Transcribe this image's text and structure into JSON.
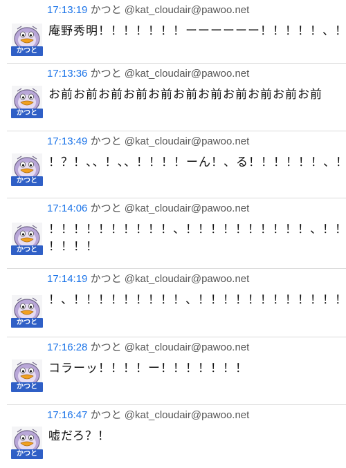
{
  "posts": [
    {
      "time": "17:13:19",
      "name": "かつと",
      "handle": "@kat_cloudair@pawoo.net",
      "lines": [
        "庵野秀明！！！！！！！ーーーーーー！！！！！、！！"
      ],
      "avatar_tag": "かつと"
    },
    {
      "time": "17:13:36",
      "name": "かつと",
      "handle": "@kat_cloudair@pawoo.net",
      "lines": [
        "お前お前お前お前お前お前お前お前お前お前お前"
      ],
      "avatar_tag": "かつと"
    },
    {
      "time": "17:13:49",
      "name": "かつと",
      "handle": "@kat_cloudair@pawoo.net",
      "lines": [
        "！？！、、！、、！！！！ーん！、る！！！！！！、！"
      ],
      "avatar_tag": "かつと"
    },
    {
      "time": "17:14:06",
      "name": "かつと",
      "handle": "@kat_cloudair@pawoo.net",
      "lines": [
        "！！！！！！！！！！、！！！！！！！！！！、！！！",
        "！！！！"
      ],
      "avatar_tag": "かつと"
    },
    {
      "time": "17:14:19",
      "name": "かつと",
      "handle": "@kat_cloudair@pawoo.net",
      "lines": [
        "！、！！！！！！！！！、！！！！！！！！！！！！、"
      ],
      "avatar_tag": "かつと"
    },
    {
      "time": "17:16:28",
      "name": "かつと",
      "handle": "@kat_cloudair@pawoo.net",
      "lines": [
        "コラーッ！！！！ー！！！！！！！"
      ],
      "avatar_tag": "かつと"
    },
    {
      "time": "17:16:47",
      "name": "かつと",
      "handle": "@kat_cloudair@pawoo.net",
      "lines": [
        "嘘だろ？！"
      ],
      "avatar_tag": "かつと"
    }
  ],
  "colors": {
    "time": "#1a73e8",
    "avatar_tag": "#2f5fc6",
    "avatar_face": "#d8c8ea",
    "beak": "#f0a020"
  }
}
